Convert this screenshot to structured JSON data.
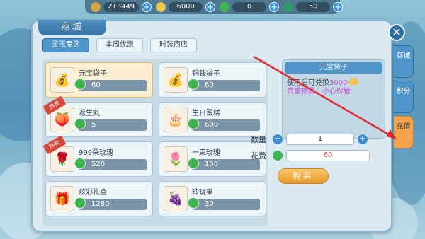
{
  "topbar": {
    "resources": [
      {
        "icon": "coin-icon",
        "value": "213449"
      },
      {
        "icon": "ingot-icon",
        "value": "6000"
      },
      {
        "icon": "jade-icon",
        "value": "0"
      },
      {
        "icon": "jade-coin-icon",
        "value": "50"
      }
    ],
    "plus": "+"
  },
  "window": {
    "title": "商城",
    "close": "✕"
  },
  "tabs": [
    {
      "label": "灵玉专区"
    },
    {
      "label": "本周优惠"
    },
    {
      "label": "时装商店"
    }
  ],
  "items": [
    {
      "name": "元宝袋子",
      "price": "60",
      "icon": "bag-icon",
      "hot": ""
    },
    {
      "name": "铜钱袋子",
      "price": "60",
      "icon": "bag-icon",
      "hot": ""
    },
    {
      "name": "返生丸",
      "price": "5",
      "icon": "pill-icon",
      "hot": "热卖"
    },
    {
      "name": "生日蛋糕",
      "price": "600",
      "icon": "cake-icon",
      "hot": ""
    },
    {
      "name": "999朵玫瑰",
      "price": "520",
      "icon": "roses-icon",
      "hot": "热卖"
    },
    {
      "name": "一束玫瑰",
      "price": "100",
      "icon": "rose-icon",
      "hot": ""
    },
    {
      "name": "炫彩礼盒",
      "price": "1280",
      "icon": "gift-icon",
      "hot": ""
    },
    {
      "name": "玲珑果",
      "price": "30",
      "icon": "fruit-icon",
      "hot": ""
    }
  ],
  "detail": {
    "title": "元宝袋子",
    "desc_prefix": "使用后可兑换",
    "desc_amount": "3000",
    "desc_note": "贵重物品，小心保管"
  },
  "purchase": {
    "qty_label": "数量",
    "qty": "1",
    "minus": "−",
    "plus": "+",
    "cost_label": "花费",
    "cost": "60",
    "buy": "购买"
  },
  "side_tabs": [
    {
      "label": "商城"
    },
    {
      "label": "积分"
    },
    {
      "label": "充值"
    }
  ],
  "colors": {
    "accent": "#4f95c9",
    "selected": "#fbeed1",
    "hot": "#d8473d",
    "buy": "#e79a2b"
  }
}
